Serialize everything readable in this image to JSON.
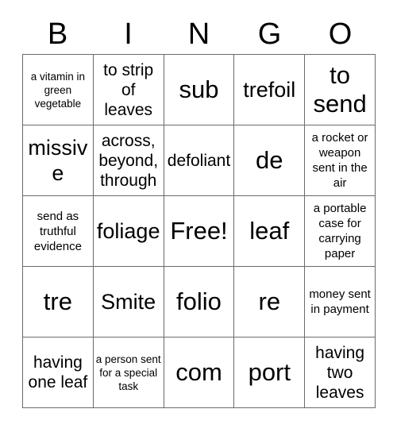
{
  "card": {
    "title": "BINGO",
    "header_letters": [
      "B",
      "I",
      "N",
      "G",
      "O"
    ],
    "free_space_label": "Free!",
    "grid_size": "5x5",
    "border_color": "#6b6b6b",
    "background_color": "#ffffff",
    "text_color": "#000000",
    "rows": [
      [
        {
          "text": "a vitamin in green vegetable",
          "size": "xs"
        },
        {
          "text": "to strip of leaves",
          "size": "md"
        },
        {
          "text": "sub",
          "size": "xl"
        },
        {
          "text": "trefoil",
          "size": "lg"
        },
        {
          "text": "to send",
          "size": "xl"
        }
      ],
      [
        {
          "text": "missive",
          "size": "lg"
        },
        {
          "text": "across, beyond, through",
          "size": "md"
        },
        {
          "text": "defoliant",
          "size": "md"
        },
        {
          "text": "de",
          "size": "xl"
        },
        {
          "text": "a rocket or weapon sent in the air",
          "size": "sm"
        }
      ],
      [
        {
          "text": "send as truthful evidence",
          "size": "sm"
        },
        {
          "text": "foliage",
          "size": "lg"
        },
        {
          "text": "Free!",
          "size": "xl"
        },
        {
          "text": "leaf",
          "size": "xl"
        },
        {
          "text": "a portable case for carrying paper",
          "size": "sm"
        }
      ],
      [
        {
          "text": "tre",
          "size": "xl"
        },
        {
          "text": "Smite",
          "size": "lg"
        },
        {
          "text": "folio",
          "size": "xl"
        },
        {
          "text": "re",
          "size": "xl"
        },
        {
          "text": "money sent in payment",
          "size": "sm"
        }
      ],
      [
        {
          "text": "having one leaf",
          "size": "md"
        },
        {
          "text": "a person sent for a special task",
          "size": "xs"
        },
        {
          "text": "com",
          "size": "xl"
        },
        {
          "text": "port",
          "size": "xl"
        },
        {
          "text": "having two leaves",
          "size": "md"
        }
      ]
    ]
  }
}
